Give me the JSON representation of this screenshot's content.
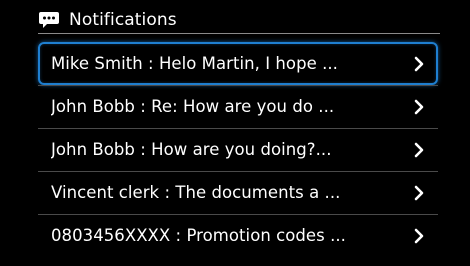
{
  "header": {
    "title": "Notifications",
    "icon": "chat-bubble-icon"
  },
  "notifications": [
    {
      "text": "Mike Smith : Helo Martin, I hope ...",
      "selected": true
    },
    {
      "text": "John Bobb : Re: How are you do ...",
      "selected": false
    },
    {
      "text": "John Bobb : How are you doing?...",
      "selected": false
    },
    {
      "text": "Vincent clerk : The documents a ...",
      "selected": false
    },
    {
      "text": "0803456XXXX : Promotion codes ...",
      "selected": false
    }
  ],
  "colors": {
    "background": "#000000",
    "text": "#ffffff",
    "selection": "#1f7fd0"
  }
}
